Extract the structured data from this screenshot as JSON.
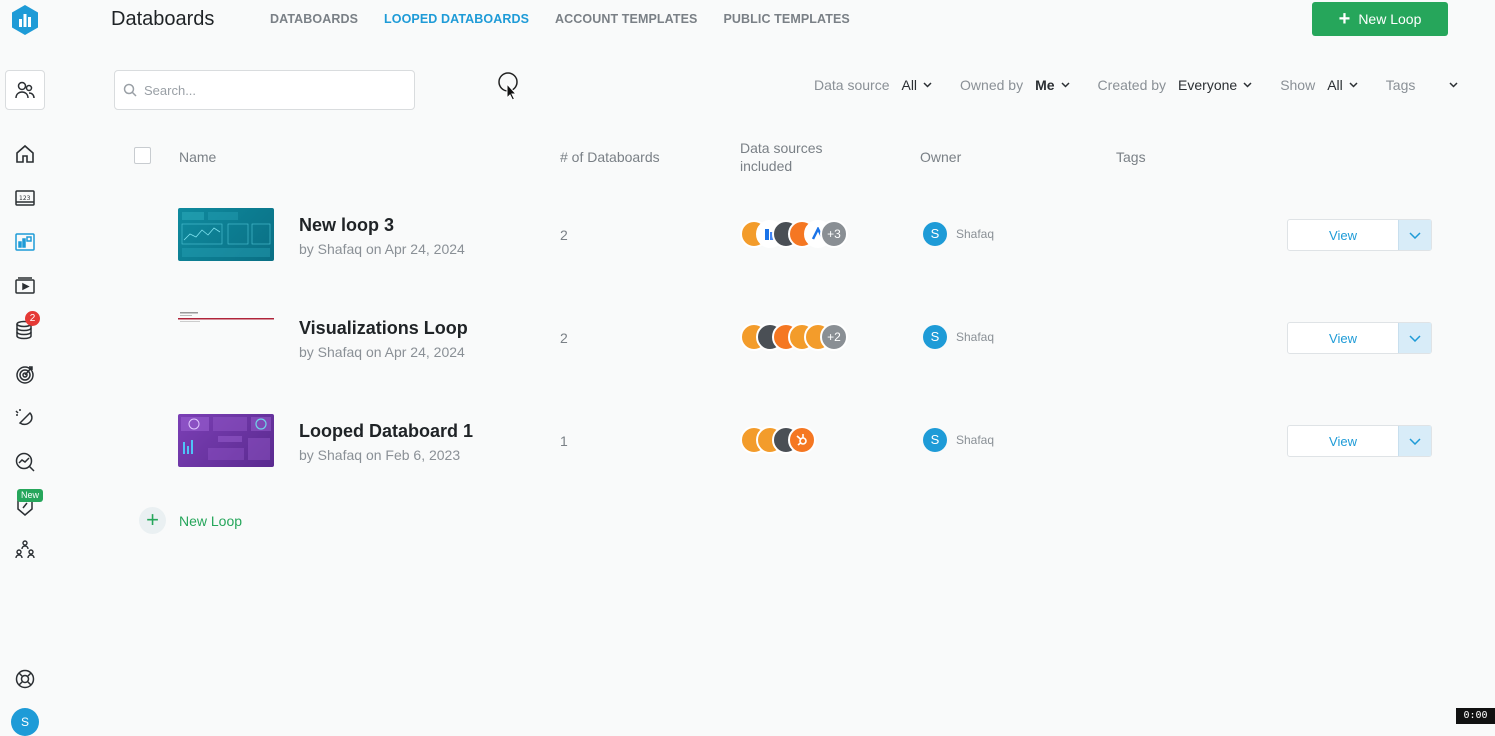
{
  "app": {
    "title": "Databoards",
    "new_loop_button": "New Loop"
  },
  "tabs": [
    {
      "label": "DATABOARDS",
      "active": false
    },
    {
      "label": "LOOPED DATABOARDS",
      "active": true
    },
    {
      "label": "ACCOUNT TEMPLATES",
      "active": false
    },
    {
      "label": "PUBLIC TEMPLATES",
      "active": false
    }
  ],
  "search": {
    "placeholder": "Search...",
    "value": ""
  },
  "filters": [
    {
      "label": "Data source",
      "value": "All"
    },
    {
      "label": "Owned by",
      "value": "Me"
    },
    {
      "label": "Created by",
      "value": "Everyone"
    },
    {
      "label": "Show",
      "value": "All"
    },
    {
      "label": "Tags",
      "value": ""
    }
  ],
  "sidebar": {
    "badge_count": "2",
    "new_badge": "New",
    "avatar_initial": "S",
    "icons": [
      "account-switch-icon",
      "home-icon",
      "metrics-icon",
      "databoards-icon",
      "presentation-icon",
      "datasources-icon",
      "goals-icon",
      "alerts-icon",
      "reports-icon",
      "benchmarks-icon",
      "team-icon",
      "help-icon"
    ]
  },
  "table": {
    "columns": {
      "name": "Name",
      "count": "# of Databoards",
      "sources": "Data sources included",
      "owner": "Owner",
      "tags": "Tags"
    },
    "rows": [
      {
        "name": "New loop 3",
        "subtitle": "by Shafaq on Apr 24, 2024",
        "count": "2",
        "extra_sources": "+3",
        "owner_initial": "S",
        "owner": "Shafaq",
        "view_label": "View"
      },
      {
        "name": "Visualizations Loop",
        "subtitle": "by Shafaq on Apr 24, 2024",
        "count": "2",
        "extra_sources": "+2",
        "owner_initial": "S",
        "owner": "Shafaq",
        "view_label": "View"
      },
      {
        "name": "Looped Databoard 1",
        "subtitle": "by Shafaq on Feb 6, 2023",
        "count": "1",
        "extra_sources": "",
        "owner_initial": "S",
        "owner": "Shafaq",
        "view_label": "View"
      }
    ]
  },
  "add_loop_label": "New Loop",
  "timer": "0:00",
  "colors": {
    "accent": "#1e9bd7",
    "brand_green": "#26a65b",
    "source_orange": "#f39c2b",
    "source_dark": "#4a4f55",
    "hubspot": "#f57722"
  }
}
